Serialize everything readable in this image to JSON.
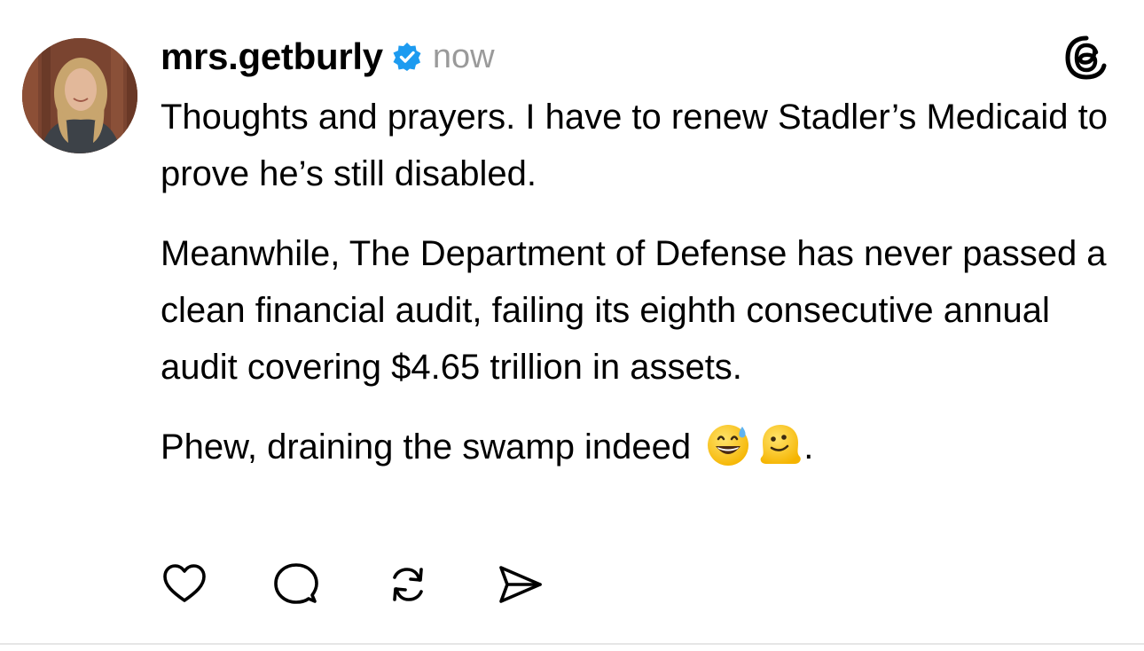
{
  "post": {
    "username": "mrs.getburly",
    "verified": true,
    "timestamp": "now",
    "avatar_icon": "user-avatar-photo",
    "app_logo_icon": "threads-logo-icon",
    "paragraphs": [
      "Thoughts and prayers. I have to renew Stadler’s Medicaid to prove he’s still disabled.",
      "Meanwhile, The Department of Defense has never passed a clean financial audit, failing its eighth consecutive annual audit covering $4.65 trillion in assets.",
      "Phew, draining the swamp indeed"
    ],
    "final_punctuation": ".",
    "emojis": [
      "grinning-face-with-sweat-emoji",
      "melting-face-emoji"
    ],
    "actions": [
      "like-heart-icon",
      "comment-bubble-icon",
      "repost-icon",
      "share-send-icon"
    ]
  },
  "colors": {
    "text": "#000000",
    "muted": "#9a9a9a",
    "verified": "#1d9bf0",
    "icon": "#000000",
    "divider": "#e6e6e6"
  }
}
